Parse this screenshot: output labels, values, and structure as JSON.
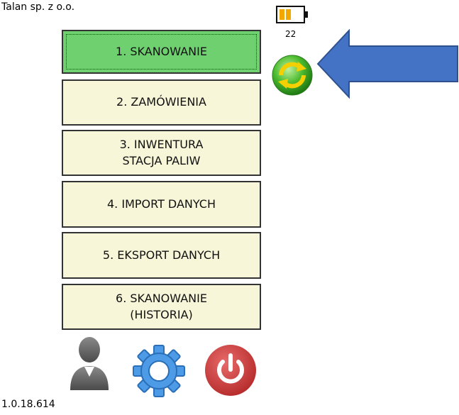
{
  "header": {
    "company": "Talan sp. z o.o.",
    "counter": "22"
  },
  "menu": {
    "items": [
      {
        "label": "1. SKANOWANIE"
      },
      {
        "label": "2. ZAMÓWIENIA"
      },
      {
        "label": "3. INWENTURA\nSTACJA PALIW"
      },
      {
        "label": "4. IMPORT DANYCH"
      },
      {
        "label": "5. EKSPORT DANYCH"
      },
      {
        "label": "6. SKANOWANIE\n(HISTORIA)"
      }
    ]
  },
  "footer": {
    "version": "1.0.18.614",
    "icons": [
      "user-icon",
      "gear-icon",
      "power-icon"
    ]
  },
  "colors": {
    "button_bg": "#f7f6d8",
    "button_active_bg": "#6fd06f",
    "arrow_fill": "#4472c4",
    "power_red": "#d23b3b",
    "gear_blue": "#4d9be6",
    "battery_level": "#f3a800"
  }
}
